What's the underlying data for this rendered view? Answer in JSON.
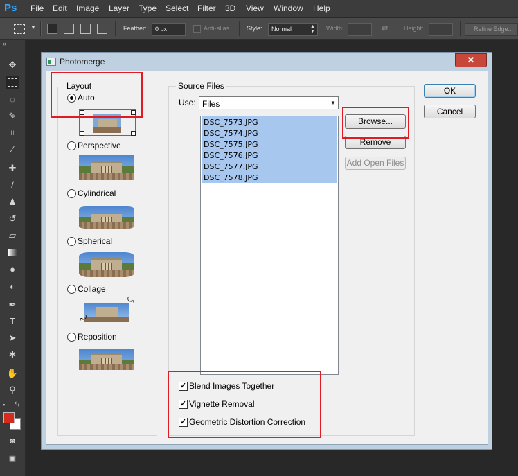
{
  "app": {
    "logo": "Ps",
    "menu": [
      "File",
      "Edit",
      "Image",
      "Layer",
      "Type",
      "Select",
      "Filter",
      "3D",
      "View",
      "Window",
      "Help"
    ]
  },
  "options_bar": {
    "feather_label": "Feather:",
    "feather_value": "0 px",
    "antialias_label": "Anti-alias",
    "style_label": "Style:",
    "style_value": "Normal",
    "width_label": "Width:",
    "height_label": "Height:",
    "refine_edge": "Refine Edge..."
  },
  "tools_panel": {
    "collapse_arrows": "»",
    "foreground_color": "#d42b1e",
    "background_color": "#ffffff"
  },
  "dialog": {
    "title": "Photomerge",
    "close_glyph": "✕",
    "layout": {
      "title": "Layout",
      "selected": "Auto",
      "options": [
        "Auto",
        "Perspective",
        "Cylindrical",
        "Spherical",
        "Collage",
        "Reposition"
      ]
    },
    "source": {
      "title": "Source Files",
      "use_label": "Use:",
      "use_value": "Files",
      "files": [
        "DSC_7573.JPG",
        "DSC_7574.JPG",
        "DSC_7575.JPG",
        "DSC_7576.JPG",
        "DSC_7577.JPG",
        "DSC_7578.JPG"
      ],
      "browse": "Browse...",
      "remove": "Remove",
      "add_open_files": "Add Open Files"
    },
    "ok": "OK",
    "cancel": "Cancel",
    "options": [
      {
        "label": "Blend Images Together",
        "checked": true
      },
      {
        "label": "Vignette Removal",
        "checked": true
      },
      {
        "label": "Geometric Distortion Correction",
        "checked": true
      }
    ]
  },
  "annotation_color": "#e01b24"
}
